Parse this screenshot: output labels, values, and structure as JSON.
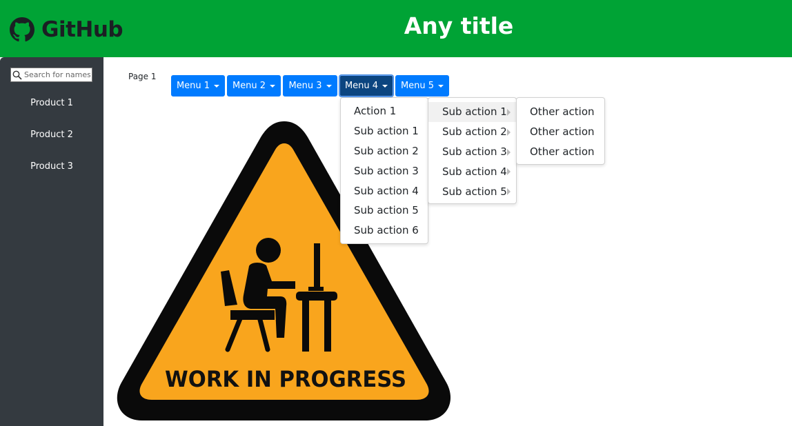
{
  "header": {
    "logo_text": "GitHub",
    "title": "Any title",
    "background_color": "#00a335"
  },
  "sidebar": {
    "search_placeholder": "Search for names",
    "items": [
      {
        "label": "Product 1"
      },
      {
        "label": "Product 2"
      },
      {
        "label": "Product 3"
      }
    ]
  },
  "main": {
    "page_label": "Page 1",
    "menus": [
      {
        "label": "Menu 1"
      },
      {
        "label": "Menu 2"
      },
      {
        "label": "Menu 3"
      },
      {
        "label": "Menu 4",
        "active": true
      },
      {
        "label": "Menu 5"
      }
    ],
    "menu4_dropdown": [
      {
        "label": "Action 1"
      },
      {
        "label": "Sub action 1"
      },
      {
        "label": "Sub action 2"
      },
      {
        "label": "Sub action 3"
      },
      {
        "label": "Sub action 4"
      },
      {
        "label": "Sub action 5"
      },
      {
        "label": "Sub action 6"
      }
    ],
    "submenu": [
      {
        "label": "Sub action 1",
        "highlighted": true
      },
      {
        "label": "Sub action 2"
      },
      {
        "label": "Sub action 3"
      },
      {
        "label": "Sub action 4"
      },
      {
        "label": "Sub action 5"
      }
    ],
    "submenu2": [
      {
        "label": "Other action"
      },
      {
        "label": "Other action"
      },
      {
        "label": "Other action"
      }
    ],
    "wip_sign_text": "WORK IN PROGRESS"
  }
}
